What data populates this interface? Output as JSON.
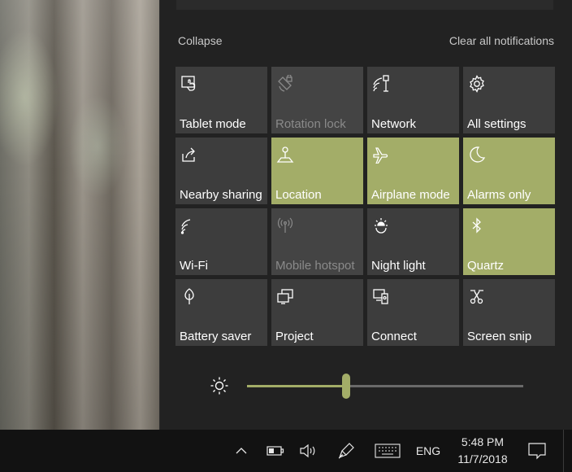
{
  "header": {
    "collapse_label": "Collapse",
    "clear_label": "Clear all notifications"
  },
  "tiles": [
    {
      "label": "Tablet mode",
      "icon": "tablet-mode-icon",
      "state": "off"
    },
    {
      "label": "Rotation lock",
      "icon": "rotation-lock-icon",
      "state": "disabled"
    },
    {
      "label": "Network",
      "icon": "network-icon",
      "state": "off"
    },
    {
      "label": "All settings",
      "icon": "gear-icon",
      "state": "off"
    },
    {
      "label": "Nearby sharing",
      "icon": "nearby-sharing-icon",
      "state": "off"
    },
    {
      "label": "Location",
      "icon": "location-icon",
      "state": "on"
    },
    {
      "label": "Airplane mode",
      "icon": "airplane-icon",
      "state": "on"
    },
    {
      "label": "Alarms only",
      "icon": "moon-icon",
      "state": "on"
    },
    {
      "label": "Wi-Fi",
      "icon": "wifi-icon",
      "state": "off"
    },
    {
      "label": "Mobile hotspot",
      "icon": "mobile-hotspot-icon",
      "state": "disabled"
    },
    {
      "label": "Night light",
      "icon": "night-light-icon",
      "state": "off"
    },
    {
      "label": "Quartz",
      "icon": "bluetooth-icon",
      "state": "on"
    },
    {
      "label": "Battery saver",
      "icon": "battery-saver-icon",
      "state": "off"
    },
    {
      "label": "Project",
      "icon": "project-icon",
      "state": "off"
    },
    {
      "label": "Connect",
      "icon": "connect-icon",
      "state": "off"
    },
    {
      "label": "Screen snip",
      "icon": "screen-snip-icon",
      "state": "off"
    }
  ],
  "brightness": {
    "icon": "brightness-icon",
    "value_fraction": 0.36
  },
  "taskbar": {
    "language": "ENG",
    "time": "5:48 PM",
    "date": "11/7/2018",
    "icons": [
      "chevron-up-icon",
      "battery-icon",
      "volume-icon",
      "pen-icon",
      "keyboard-icon",
      "notification-icon"
    ]
  },
  "colors": {
    "accent": "#a3ad68",
    "tile_off": "#3d3d3d",
    "panel": "#222222",
    "taskbar": "#121212"
  }
}
